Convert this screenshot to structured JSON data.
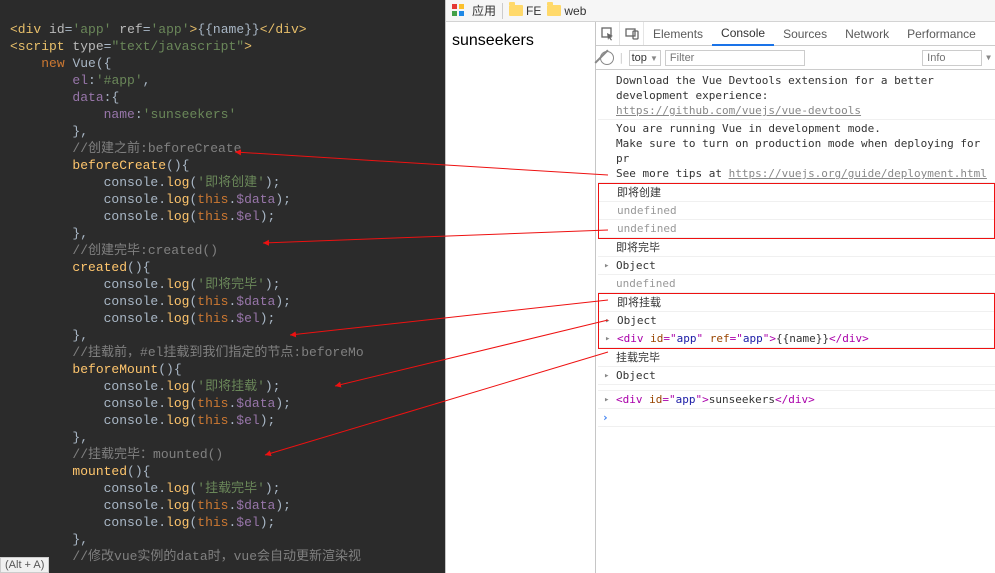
{
  "editor": {
    "lines": [
      "<div id='app' ref='app'>{{name}}</div>",
      "<script type=\"text/javascript\">",
      "    new Vue({",
      "        el:'#app',",
      "        data:{",
      "            name:'sunseekers'",
      "        },",
      "        //创建之前:beforeCreate",
      "        beforeCreate(){",
      "            console.log('即将创建');",
      "            console.log(this.$data);",
      "            console.log(this.$el);",
      "        },",
      "        //创建完毕:created()",
      "        created(){",
      "            console.log('即将完毕');",
      "            console.log(this.$data);",
      "            console.log(this.$el);",
      "        },",
      "        //挂载前，#el挂载到我们指定的节点:beforeMo",
      "        beforeMount(){",
      "            console.log('即将挂载');",
      "            console.log(this.$data);",
      "            console.log(this.$el);",
      "        },",
      "        //挂载完毕：mounted()",
      "        mounted(){",
      "            console.log('挂载完毕');",
      "            console.log(this.$data);",
      "            console.log(this.$el);",
      "        },",
      "        //修改vue实例的data时，vue会自动更新渲染视"
    ]
  },
  "bookmarks": {
    "apps": "应用",
    "folders": [
      "FE",
      "web"
    ]
  },
  "page": {
    "content": "sunseekers"
  },
  "devtools": {
    "tabs": [
      "Elements",
      "Console",
      "Sources",
      "Network",
      "Performance"
    ],
    "active_tab": "Console",
    "toolbar": {
      "context": "top",
      "filter_placeholder": "Filter",
      "info_placeholder": "Info"
    },
    "console": {
      "msg_download": "Download the Vue Devtools extension for a better development experience:",
      "link_devtools": "https://github.com/vuejs/vue-devtools",
      "msg_devmode": "You are running Vue in development mode.",
      "msg_prod": "Make sure to turn on production mode when deploying for pr",
      "msg_tips_pre": "See more tips at ",
      "link_deploy": "https://vuejs.org/guide/deployment.html",
      "l_create": "即将创建",
      "undef1": "undefined",
      "undef2": "undefined",
      "l_created_done": "即将完毕",
      "obj1": "Object",
      "undef3": "undefined",
      "l_mount": "即将挂载",
      "obj2": "Object",
      "el_raw_pre": "<div ",
      "el_raw_id": "id",
      "el_raw_eq": "=\"",
      "el_raw_app": "app",
      "el_raw_mid": "\" ",
      "el_raw_ref": "ref",
      "el_raw_app2": "app",
      "el_raw_txt": "{{name}}",
      "el_raw_close": "</div>",
      "l_mounted_done": "挂载完毕",
      "obj3": "Object",
      "el_final_pre": "<div ",
      "el_final_id": "id",
      "el_final_app": "app",
      "el_final_txt": "sunseekers",
      "el_final_close": "</div>"
    }
  },
  "status": {
    "alt_a": "(Alt + A)"
  }
}
